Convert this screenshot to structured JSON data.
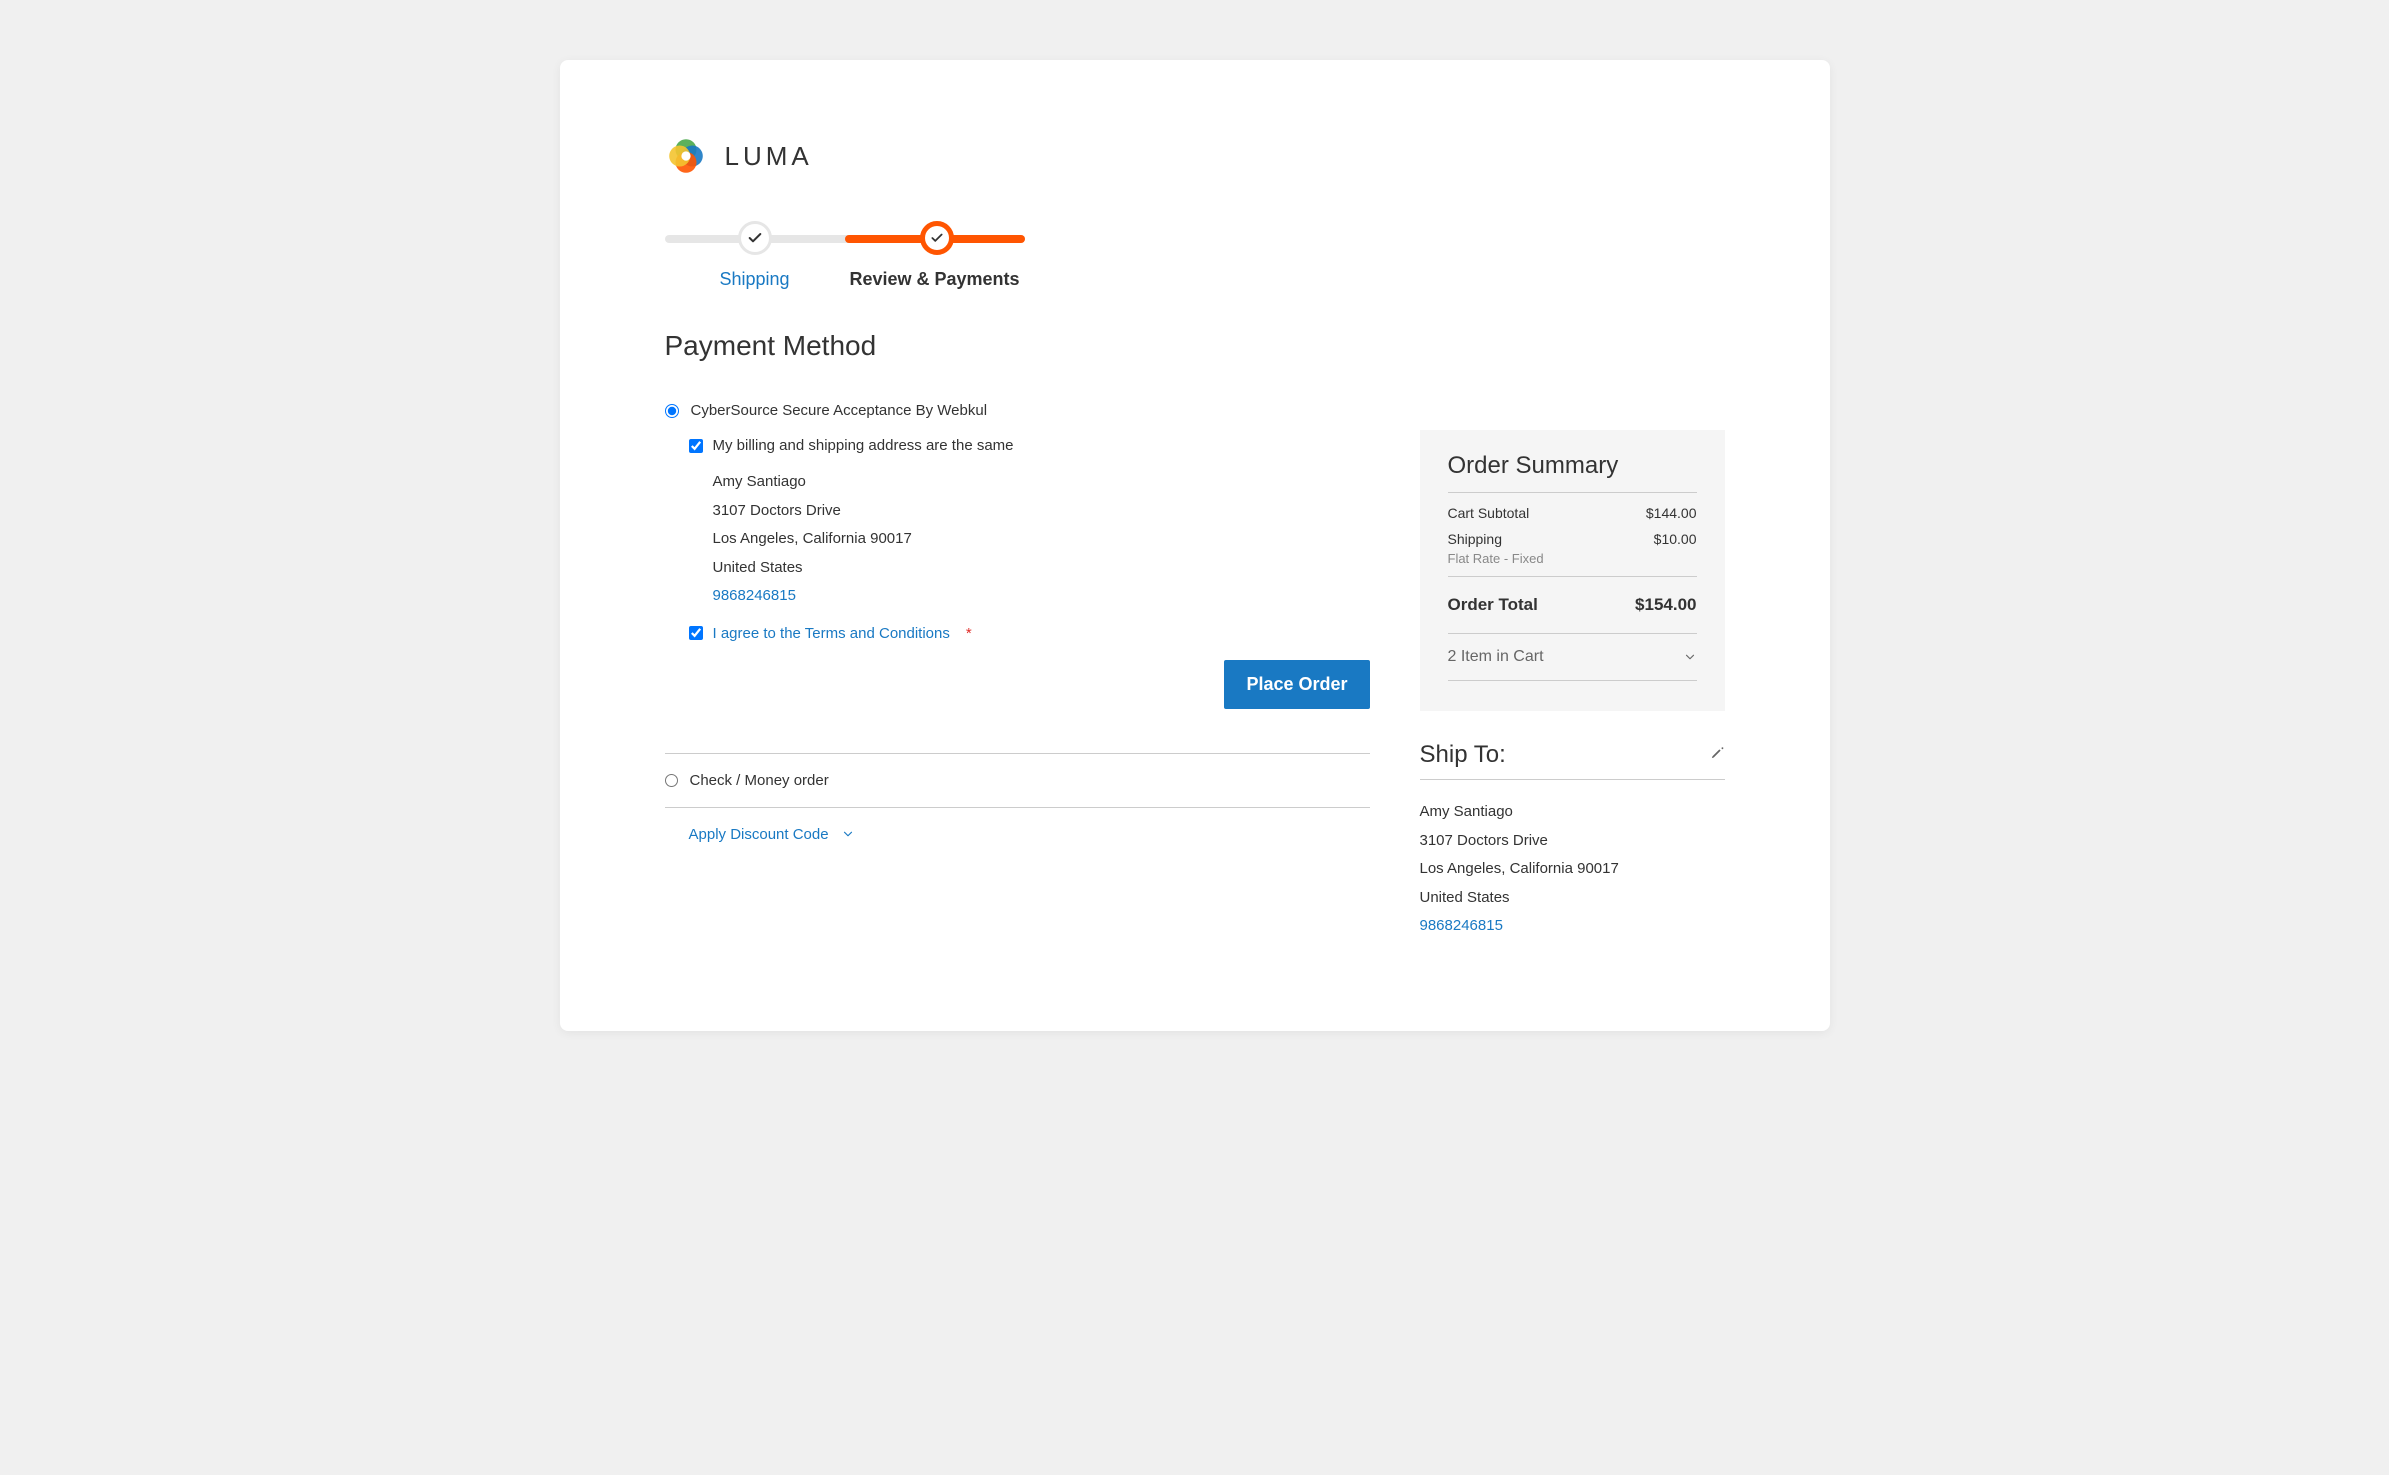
{
  "brand": "LUMA",
  "progress": {
    "shipping": "Shipping",
    "review": "Review & Payments"
  },
  "page_title": "Payment Method",
  "payment": {
    "option1_label": "CyberSource Secure Acceptance By Webkul",
    "same_address_label": "My billing and shipping address are the same",
    "address": {
      "name": "Amy Santiago",
      "street": "3107 Doctors Drive",
      "city_state_zip": "Los Angeles, California 90017",
      "country": "United States",
      "phone": "9868246815"
    },
    "terms_label": "I agree to the Terms and Conditions",
    "place_order": "Place Order",
    "option2_label": "Check / Money order",
    "discount_label": "Apply Discount Code"
  },
  "summary": {
    "title": "Order Summary",
    "subtotal_label": "Cart Subtotal",
    "subtotal_value": "$144.00",
    "shipping_label": "Shipping",
    "shipping_value": "$10.00",
    "shipping_method": "Flat Rate - Fixed",
    "total_label": "Order Total",
    "total_value": "$154.00",
    "items_in_cart": "2 Item in Cart"
  },
  "ship_to": {
    "title": "Ship To:",
    "name": "Amy Santiago",
    "street": "3107 Doctors Drive",
    "city_state_zip": "Los Angeles, California 90017",
    "country": "United States",
    "phone": "9868246815"
  }
}
